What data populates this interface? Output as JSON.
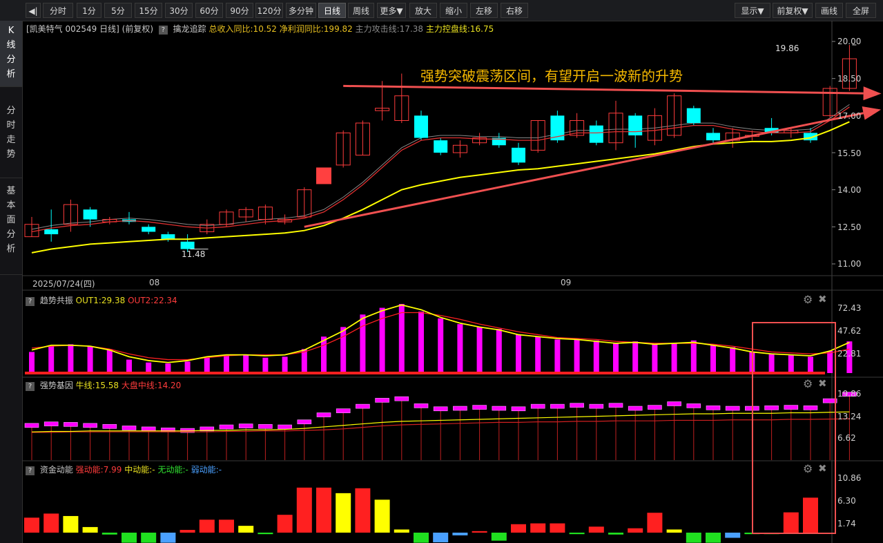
{
  "toolbar": {
    "back_icon": "panel-toggle-icon",
    "periods": [
      "分时",
      "1分",
      "5分",
      "15分",
      "30分",
      "60分",
      "90分",
      "120分",
      "多分钟",
      "日线",
      "周线",
      "更多▼"
    ],
    "active_period": "日线",
    "zoom_in": "放大",
    "zoom_out": "缩小",
    "left": "左移",
    "right": "右移",
    "display": "显示▼",
    "adjust": "前复权▼",
    "draw": "画线",
    "fullscreen": "全屏"
  },
  "left_tabs": [
    {
      "label": "K线分析",
      "active": true
    },
    {
      "label": "分时走势",
      "active": false
    },
    {
      "label": "基本面分析",
      "active": false
    }
  ],
  "main_info": {
    "stock": "[凯美特气 002549 日线]",
    "adjust": "(前复权)",
    "indicator": "擒龙追踪",
    "rev_yoy": "总收入同比:10.52",
    "profit_yoy": "净利润同比:199.82",
    "attack_line": "主力攻击线:17.38",
    "control_line": "主力控盘线:16.75"
  },
  "annotation": "强势突破震荡区间，有望开启一波新的升势",
  "price_axis": [
    "20.00",
    "18.50",
    "17.00",
    "15.50",
    "14.00",
    "12.50",
    "11.00"
  ],
  "price_labels": {
    "high": "19.86",
    "low": "11.48"
  },
  "date_axis": {
    "first": "2025/07/24(四)",
    "m8": "08",
    "m9": "09"
  },
  "panel1": {
    "name": "趋势共振",
    "out1": "OUT1:29.38",
    "out2": "OUT2:22.34",
    "axis": [
      "72.43",
      "47.62",
      "22.81"
    ]
  },
  "panel2": {
    "name": "强势基因",
    "bull": "牛线:15.58",
    "market": "大盘中线:14.20",
    "axis": [
      "19.86",
      "13.24",
      "6.62"
    ]
  },
  "panel3": {
    "name": "资金动能",
    "strong": "强动能:7.99",
    "mid": "中动能:-",
    "none": "无动能:-",
    "weak": "弱动能:-",
    "axis": [
      "10.86",
      "6.30",
      "1.74"
    ]
  },
  "colors": {
    "up": "#ff3c3c",
    "down": "#00ffff",
    "ma_yellow": "#ffff00",
    "ma_red": "#e03030",
    "magenta": "#ff00ff",
    "annotation": "#f5b800"
  },
  "chart_data": {
    "type": "candlestick",
    "candles": [
      [
        12.1,
        12.6,
        12.9,
        12.1
      ],
      [
        12.4,
        12.2,
        13.2,
        11.9
      ],
      [
        12.6,
        13.4,
        13.6,
        12.3
      ],
      [
        13.2,
        12.8,
        13.3,
        12.5
      ],
      [
        12.7,
        12.8,
        12.9,
        12.6
      ],
      [
        12.8,
        12.7,
        13.1,
        12.6
      ],
      [
        12.5,
        12.3,
        12.6,
        12.2
      ],
      [
        12.2,
        12.0,
        12.3,
        11.9
      ],
      [
        11.9,
        11.6,
        12.2,
        11.48
      ],
      [
        12.3,
        12.6,
        12.8,
        12.2
      ],
      [
        12.6,
        13.1,
        13.2,
        12.5
      ],
      [
        12.9,
        13.2,
        13.3,
        12.7
      ],
      [
        12.8,
        13.3,
        13.4,
        12.6
      ],
      [
        12.7,
        12.8,
        13.0,
        12.6
      ],
      [
        12.9,
        14.0,
        14.1,
        12.9
      ],
      [
        14.4,
        14.4,
        14.4,
        14.4
      ],
      [
        15.0,
        16.3,
        16.4,
        14.9
      ],
      [
        15.4,
        16.7,
        16.8,
        15.4
      ],
      [
        17.2,
        17.3,
        18.4,
        16.8
      ],
      [
        16.8,
        17.8,
        18.7,
        16.7
      ],
      [
        17.0,
        16.1,
        17.2,
        16.0
      ],
      [
        16.0,
        15.5,
        16.1,
        15.4
      ],
      [
        15.5,
        15.8,
        16.0,
        15.3
      ],
      [
        15.9,
        16.1,
        16.3,
        15.8
      ],
      [
        16.1,
        15.8,
        16.3,
        15.7
      ],
      [
        15.7,
        15.1,
        15.9,
        15.0
      ],
      [
        15.6,
        16.8,
        16.8,
        15.5
      ],
      [
        17.0,
        16.0,
        17.2,
        15.9
      ],
      [
        16.2,
        16.8,
        17.1,
        16.1
      ],
      [
        16.6,
        15.9,
        16.8,
        15.8
      ],
      [
        15.9,
        17.1,
        17.6,
        15.6
      ],
      [
        17.0,
        16.2,
        17.1,
        15.7
      ],
      [
        16.0,
        17.0,
        17.3,
        15.8
      ],
      [
        16.2,
        17.8,
        17.9,
        16.1
      ],
      [
        17.3,
        16.7,
        17.4,
        16.6
      ],
      [
        16.3,
        16.0,
        16.5,
        15.9
      ],
      [
        16.0,
        16.3,
        16.5,
        15.7
      ],
      [
        16.2,
        16.2,
        16.4,
        16.0
      ],
      [
        16.5,
        16.3,
        16.9,
        16.2
      ],
      [
        16.3,
        16.4,
        16.5,
        16.1
      ],
      [
        16.3,
        16.0,
        16.5,
        15.9
      ],
      [
        17.0,
        18.1,
        18.2,
        16.9
      ],
      [
        18.1,
        19.3,
        19.86,
        18.0
      ]
    ],
    "ma_short": [
      12.3,
      12.45,
      12.55,
      12.6,
      12.7,
      12.75,
      12.7,
      12.6,
      12.5,
      12.45,
      12.5,
      12.6,
      12.7,
      12.75,
      12.85,
      13.1,
      13.6,
      14.2,
      14.9,
      15.6,
      16.0,
      16.1,
      16.1,
      16.05,
      16.05,
      16.0,
      16.0,
      16.15,
      16.3,
      16.3,
      16.35,
      16.35,
      16.4,
      16.5,
      16.6,
      16.6,
      16.45,
      16.35,
      16.3,
      16.3,
      16.35,
      16.8,
      17.35
    ],
    "ma_long": [
      11.45,
      11.6,
      11.7,
      11.8,
      11.85,
      11.9,
      11.95,
      12.0,
      12.0,
      12.05,
      12.1,
      12.15,
      12.2,
      12.25,
      12.35,
      12.55,
      12.85,
      13.2,
      13.6,
      14.0,
      14.2,
      14.35,
      14.5,
      14.6,
      14.7,
      14.8,
      14.85,
      14.95,
      15.05,
      15.15,
      15.25,
      15.35,
      15.45,
      15.6,
      15.75,
      15.85,
      15.9,
      15.95,
      15.95,
      16.0,
      16.1,
      16.4,
      16.75
    ],
    "trend_lines": [
      {
        "from": [
          14,
          12.5
        ],
        "to": [
          43,
          17.1
        ]
      },
      {
        "from": [
          16,
          18.2
        ],
        "to": [
          43,
          17.9
        ]
      }
    ],
    "osc_bars": [
      22,
      29,
      30,
      28,
      25,
      14,
      11,
      10,
      12,
      16,
      19,
      19,
      16,
      17,
      25,
      38,
      48,
      61,
      68,
      72,
      64,
      57,
      51,
      48,
      46,
      40,
      38,
      35,
      36,
      34,
      31,
      33,
      30,
      31,
      34,
      29,
      27,
      22,
      20,
      19,
      17,
      23,
      33
    ],
    "osc_yellow": [
      24,
      29,
      29,
      28,
      24,
      17,
      13,
      11,
      13,
      17,
      19,
      19,
      18,
      19,
      24,
      34,
      44,
      57,
      65,
      71,
      66,
      58,
      52,
      48,
      45,
      40,
      38,
      36,
      35,
      33,
      31,
      32,
      30,
      31,
      32,
      29,
      26,
      22,
      20,
      19,
      18,
      23,
      32
    ],
    "osc_red": [
      26,
      28,
      29,
      28,
      25,
      20,
      16,
      14,
      14,
      16,
      18,
      19,
      19,
      19,
      22,
      29,
      38,
      49,
      57,
      63,
      63,
      60,
      56,
      51,
      47,
      43,
      40,
      37,
      36,
      35,
      33,
      32,
      31,
      31,
      31,
      30,
      28,
      25,
      22,
      21,
      20,
      21,
      25
    ],
    "gene_tops": [
      13.3,
      13.6,
      13.5,
      13.3,
      13.1,
      12.8,
      12.6,
      12.4,
      12.3,
      12.6,
      13.0,
      13.2,
      13.1,
      13.0,
      14.0,
      15.4,
      16.2,
      17.1,
      18.3,
      18.6,
      17.2,
      16.6,
      16.7,
      16.9,
      16.7,
      16.6,
      17.1,
      17.1,
      17.3,
      17.1,
      17.3,
      16.7,
      16.9,
      17.6,
      17.2,
      16.8,
      16.7,
      16.7,
      16.8,
      16.9,
      16.8,
      18.2,
      19.5
    ],
    "gene_yellow": [
      11.6,
      11.7,
      11.7,
      11.8,
      11.8,
      11.8,
      11.8,
      11.8,
      11.8,
      11.9,
      11.9,
      12.0,
      12.0,
      12.1,
      12.3,
      12.6,
      12.9,
      13.2,
      13.5,
      13.7,
      13.8,
      13.9,
      14.0,
      14.1,
      14.2,
      14.3,
      14.4,
      14.5,
      14.6,
      14.7,
      14.8,
      14.9,
      15.0,
      15.1,
      15.2,
      15.2,
      15.3,
      15.3,
      15.3,
      15.4,
      15.4,
      15.5,
      15.58
    ],
    "gene_red": [
      11.5,
      11.5,
      11.6,
      11.6,
      11.6,
      11.6,
      11.6,
      11.6,
      11.6,
      11.6,
      11.7,
      11.7,
      11.8,
      11.8,
      11.9,
      12.0,
      12.2,
      12.5,
      12.8,
      13.0,
      13.1,
      13.2,
      13.3,
      13.4,
      13.5,
      13.5,
      13.6,
      13.6,
      13.7,
      13.7,
      13.8,
      13.8,
      13.8,
      13.9,
      13.9,
      13.9,
      14.0,
      14.0,
      14.0,
      14.1,
      14.1,
      14.15,
      14.2
    ],
    "flow": [
      [
        3.5,
        "r"
      ],
      [
        4.5,
        "r"
      ],
      [
        3.9,
        "y"
      ],
      [
        1.2,
        "y"
      ],
      [
        -0.3,
        "g"
      ],
      [
        -2.3,
        "g"
      ],
      [
        -2.3,
        "g"
      ],
      [
        -2.3,
        "b"
      ],
      [
        0.5,
        "r"
      ],
      [
        3.0,
        "r"
      ],
      [
        3.0,
        "r"
      ],
      [
        1.5,
        "y"
      ],
      [
        -0.2,
        "g"
      ],
      [
        4.2,
        "r"
      ],
      [
        10.86,
        "r"
      ],
      [
        10.86,
        "r"
      ],
      [
        9.5,
        "y"
      ],
      [
        10.7,
        "r"
      ],
      [
        7.9,
        "y"
      ],
      [
        0.6,
        "y"
      ],
      [
        -2.3,
        "g"
      ],
      [
        -2.2,
        "b"
      ],
      [
        -0.5,
        "b"
      ],
      [
        0.2,
        "r"
      ],
      [
        -1.8,
        "g"
      ],
      [
        1.9,
        "r"
      ],
      [
        2.1,
        "r"
      ],
      [
        2.1,
        "r"
      ],
      [
        -0.2,
        "g"
      ],
      [
        1.3,
        "r"
      ],
      [
        -0.3,
        "g"
      ],
      [
        0.9,
        "r"
      ],
      [
        4.7,
        "r"
      ],
      [
        0.6,
        "y"
      ],
      [
        -2.3,
        "g"
      ],
      [
        -2.3,
        "g"
      ],
      [
        -1.1,
        "b"
      ],
      [
        -0.2,
        "g"
      ],
      [
        -0.2,
        "g"
      ],
      [
        4.8,
        "r"
      ],
      [
        8.4,
        "r"
      ]
    ]
  }
}
